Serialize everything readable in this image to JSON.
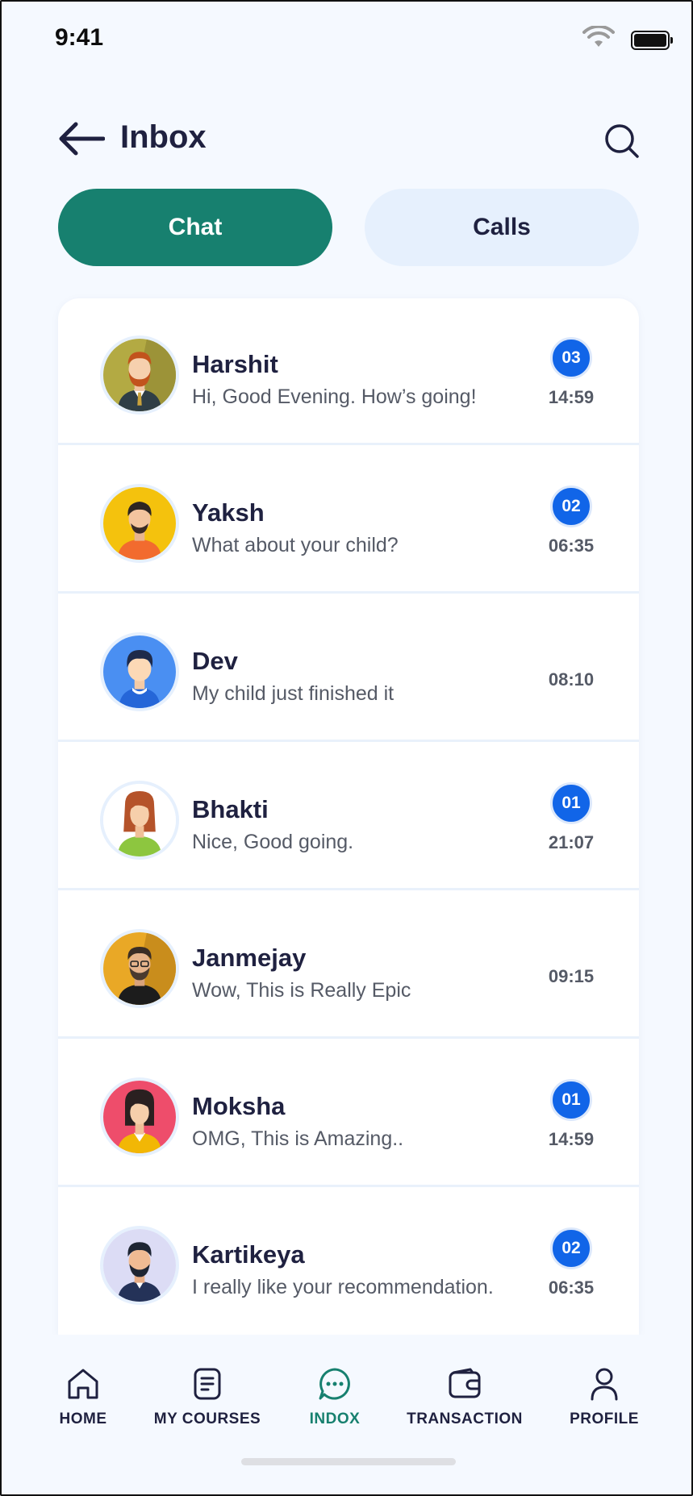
{
  "status_bar": {
    "time": "9:41"
  },
  "header": {
    "title": "Inbox"
  },
  "tabs": [
    {
      "label": "Chat",
      "active": true
    },
    {
      "label": "Calls",
      "active": false
    }
  ],
  "chats": [
    {
      "name": "Harshit",
      "message": "Hi, Good Evening. How’s going!",
      "unread": "03",
      "time": "14:59"
    },
    {
      "name": "Yaksh",
      "message": "What about your child?",
      "unread": "02",
      "time": "06:35"
    },
    {
      "name": "Dev",
      "message": "My child just finished it",
      "unread": null,
      "time": "08:10"
    },
    {
      "name": "Bhakti",
      "message": "Nice, Good going.",
      "unread": "01",
      "time": "21:07"
    },
    {
      "name": "Janmejay",
      "message": "Wow, This is Really Epic",
      "unread": null,
      "time": "09:15"
    },
    {
      "name": "Moksha",
      "message": "OMG, This is Amazing..",
      "unread": "01",
      "time": "14:59"
    },
    {
      "name": "Kartikeya",
      "message": "I really like your recommendation.",
      "unread": "02",
      "time": "06:35"
    }
  ],
  "bottom_nav": [
    {
      "label": "HOME",
      "icon": "home-icon",
      "active": false
    },
    {
      "label": "MY COURSES",
      "icon": "courses-icon",
      "active": false
    },
    {
      "label": "INDOX",
      "icon": "chat-icon",
      "active": true
    },
    {
      "label": "TRANSACTION",
      "icon": "wallet-icon",
      "active": false
    },
    {
      "label": "PROFILE",
      "icon": "profile-icon",
      "active": false
    }
  ],
  "colors": {
    "accent": "#17806f",
    "badge": "#1165e8",
    "background": "#f5f9ff",
    "text_primary": "#1f2140"
  }
}
